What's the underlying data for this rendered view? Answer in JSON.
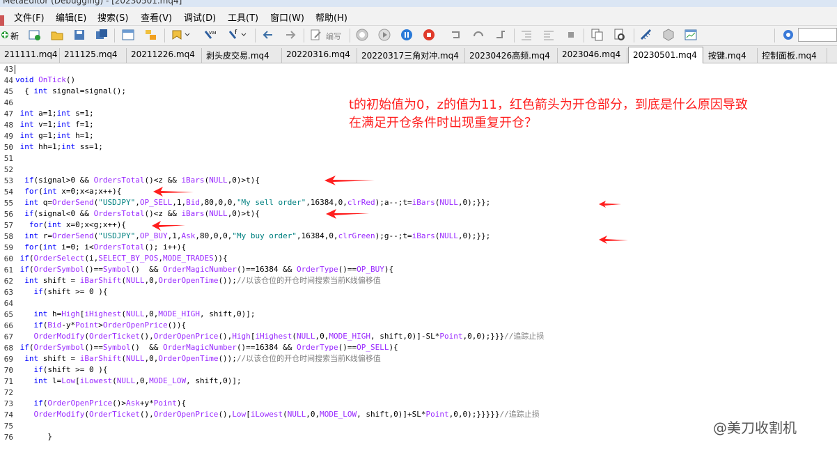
{
  "window": {
    "title": "MetaEditor (Debugging) - [20230501.mq4]"
  },
  "menu": [
    "文件(F)",
    "编辑(E)",
    "搜索(S)",
    "查看(V)",
    "调试(D)",
    "工具(T)",
    "窗口(W)",
    "帮助(H)"
  ],
  "toolbar": {
    "new_label": "新",
    "compile_label": "编写"
  },
  "tabs": [
    {
      "label": "211111.mq4",
      "active": false
    },
    {
      "label": "211125.mq4",
      "active": false
    },
    {
      "label": "20211226.mq4",
      "active": false
    },
    {
      "label": "剥头皮交易.mq4",
      "active": false
    },
    {
      "label": "20220316.mq4",
      "active": false
    },
    {
      "label": "20220317三角对冲.mq4",
      "active": false
    },
    {
      "label": "20230426高频.mq4",
      "active": false
    },
    {
      "label": "2023046.mq4",
      "active": false
    },
    {
      "label": "20230501.mq4",
      "active": true
    },
    {
      "label": "按键.mq4",
      "active": false
    },
    {
      "label": "控制面板.mq4",
      "active": false
    }
  ],
  "editor": {
    "line_numbers": [
      "43",
      "44",
      "45",
      "46",
      "47",
      "48",
      "49",
      "50",
      "51",
      "52",
      "53",
      "54",
      "55",
      "56",
      "57",
      "58",
      "59",
      "60",
      "61",
      "62",
      "63",
      "64",
      "65",
      "66",
      "67",
      "68",
      "69",
      "70",
      "71",
      "72",
      "73",
      "74",
      "75",
      "76"
    ],
    "lines": [
      "",
      "void OnTick()",
      "  { int signal=signal();",
      "",
      " int a=1;int s=1;",
      " int v=1;int f=1;",
      " int g=1;int h=1;",
      " int hh=1;int ss=1;",
      "",
      "",
      "  if(signal>0 && OrdersTotal()<z && iBars(NULL,0)>t){",
      "  for(int x=0;x<a;x++){",
      "  int q=OrderSend(\"USDJPY\",OP_SELL,1,Bid,80,0,0,\"My sell order\",16384,0,clrRed);a--;t=iBars(NULL,0);}};",
      "  if(signal<0 && OrdersTotal()<z && iBars(NULL,0)>t){",
      "   for(int x=0;x<g;x++){",
      "  int r=OrderSend(\"USDJPY\",OP_BUY,1,Ask,80,0,0,\"My buy order\",16384,0,clrGreen);g--;t=iBars(NULL,0);}};",
      "  for(int i=0; i<OrdersTotal(); i++){",
      " if(OrderSelect(i,SELECT_BY_POS,MODE_TRADES)){",
      " if(OrderSymbol()==Symbol()  && OrderMagicNumber()==16384 && OrderType()==OP_BUY){",
      "  int shift = iBarShift(NULL,0,OrderOpenTime());//以该仓位的开仓时间搜索当前K线偏移值",
      "    if(shift >= 0 ){",
      "",
      "    int h=High[iHighest(NULL,0,MODE_HIGH, shift,0)];",
      "    if(Bid-y*Point>OrderOpenPrice()){",
      "    OrderModify(OrderTicket(),OrderOpenPrice(),High[iHighest(NULL,0,MODE_HIGH, shift,0)]-SL*Point,0,0);}}}//追踪止损",
      " if(OrderSymbol()==Symbol()  && OrderMagicNumber()==16384 && OrderType()==OP_SELL){",
      "  int shift = iBarShift(NULL,0,OrderOpenTime());//以该仓位的开仓时间搜索当前K线偏移值",
      "    if(shift >= 0 ){",
      "    int l=Low[iLowest(NULL,0,MODE_LOW, shift,0)];",
      "",
      "    if(OrderOpenPrice()>Ask+y*Point){",
      "    OrderModify(OrderTicket(),OrderOpenPrice(),Low[iLowest(NULL,0,MODE_LOW, shift,0)]+SL*Point,0,0);}}}}}//追踪止损",
      "",
      "       }"
    ]
  },
  "annotation": {
    "line1": "t的初始值为0，z的值为11，红色箭头为开仓部分，到底是什么原因导致",
    "line2": "在满足开仓条件时出现重复开仓？",
    "color": "#ff1f1f"
  },
  "watermark": "@美刀收割机",
  "colors": {
    "keyword": "#0000ff",
    "function": "#9a2bff",
    "string": "#008080",
    "comment": "#808080",
    "arrow": "#ff1f1f"
  }
}
